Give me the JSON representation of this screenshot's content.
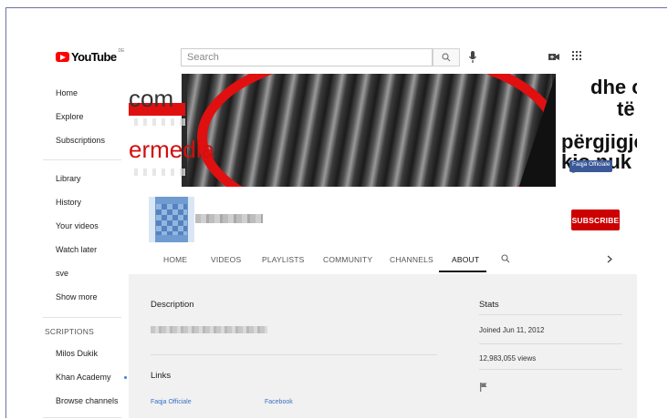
{
  "topbar": {
    "logo_text": "YouTube",
    "logo_country": "DE",
    "search_placeholder": "Search"
  },
  "sidebar": {
    "items": [
      "Home",
      "Explore",
      "Subscriptions",
      "Library",
      "History",
      "Your videos",
      "Watch later",
      "sve",
      "Show more"
    ],
    "section_header": "SCRIPTIONS",
    "subscriptions": [
      "Milos Dukik",
      "Khan Academy",
      "Browse channels"
    ]
  },
  "banner": {
    "left_top": "com",
    "left_bottom": "ermedia",
    "right_line1": "dhe c",
    "right_line2": "të",
    "right_line3": "përgjigje",
    "right_line4": "kjo nuk c",
    "fb_chip": "Faqja Officiale"
  },
  "channel": {
    "subscribe_label": "SUBSCRIBE"
  },
  "tabs": [
    "HOME",
    "VIDEOS",
    "PLAYLISTS",
    "COMMUNITY",
    "CHANNELS",
    "ABOUT"
  ],
  "about": {
    "description_heading": "Description",
    "links_heading": "Links",
    "links": [
      "Faqja Officiale",
      "Facebook"
    ],
    "stats_heading": "Stats",
    "joined": "Joined Jun 11, 2012",
    "views": "12,983,055 views"
  },
  "colors": {
    "brand_red": "#cc0000",
    "link_blue": "#3b6fc6"
  }
}
